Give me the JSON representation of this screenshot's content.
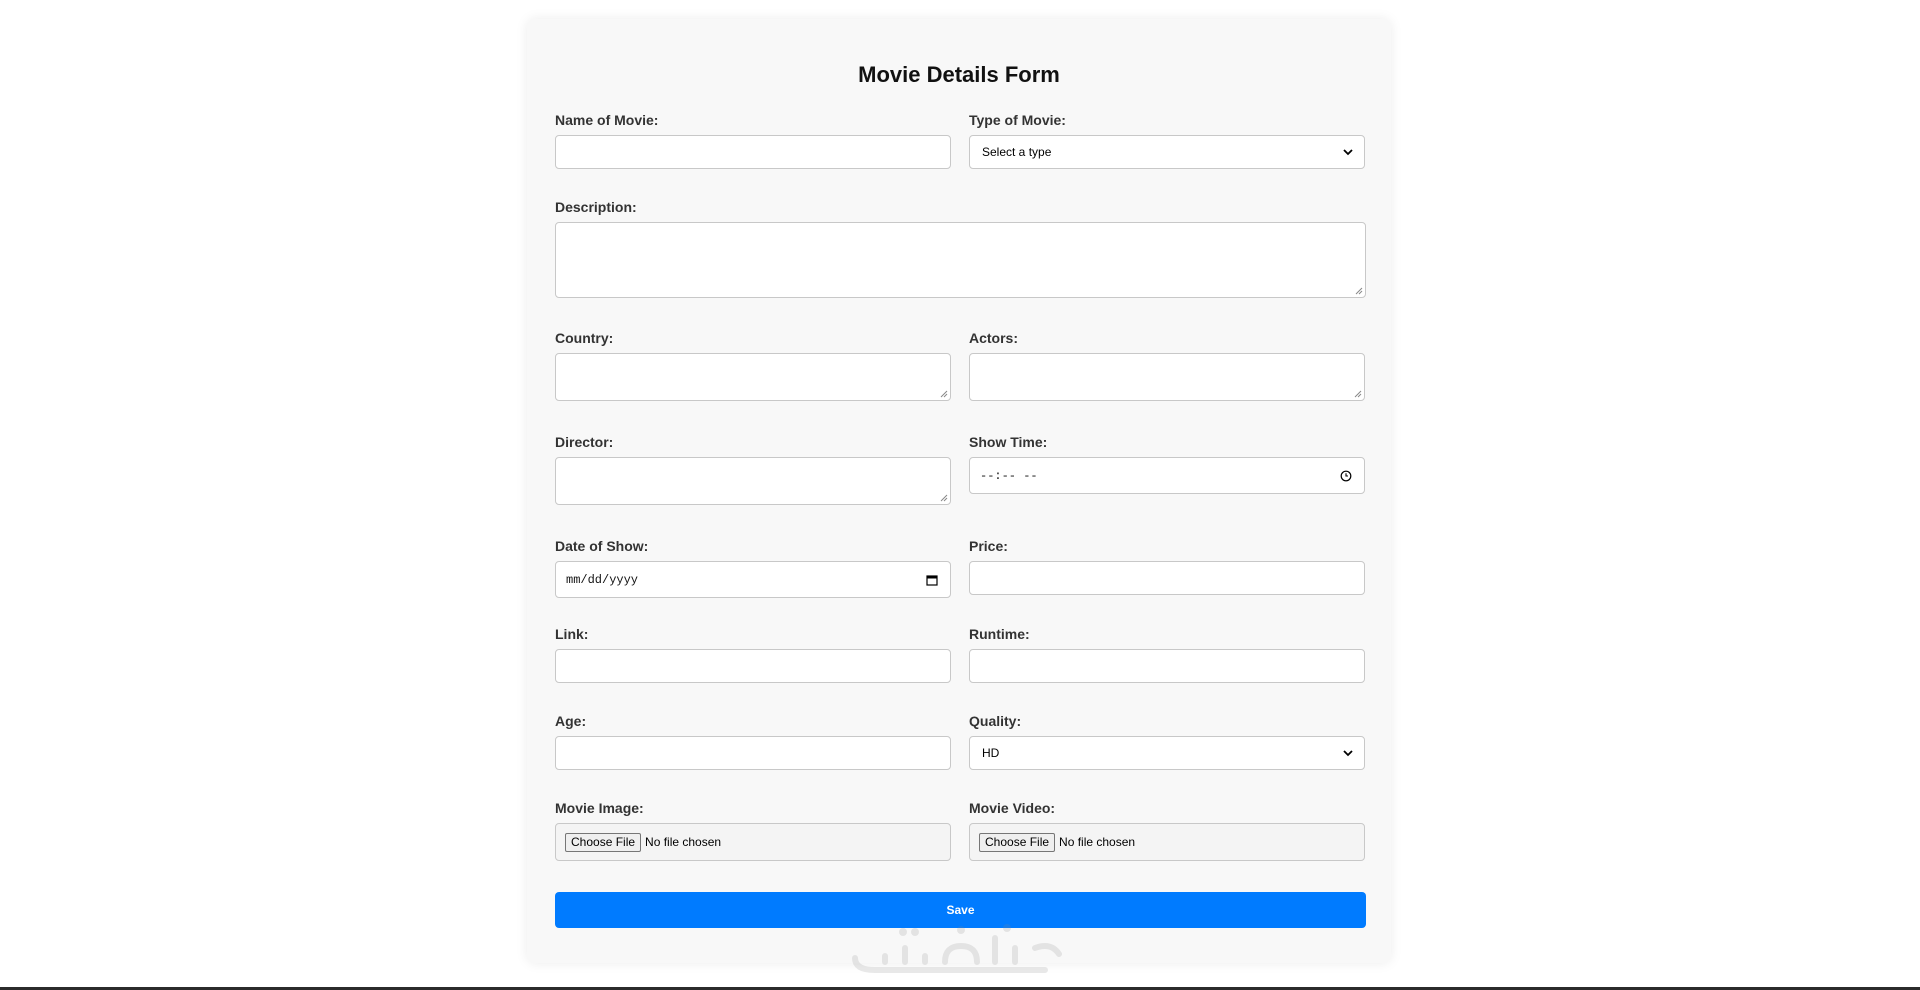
{
  "form": {
    "title": "Movie Details Form",
    "fields": {
      "name_of_movie": {
        "label": "Name of Movie:",
        "value": ""
      },
      "type_of_movie": {
        "label": "Type of Movie:",
        "selected": "Select a type"
      },
      "description": {
        "label": "Description:",
        "value": ""
      },
      "country": {
        "label": "Country:",
        "value": ""
      },
      "actors": {
        "label": "Actors:",
        "value": ""
      },
      "director": {
        "label": "Director:",
        "value": ""
      },
      "show_time": {
        "label": "Show Time:",
        "placeholder": "--:-- --"
      },
      "date_of_show": {
        "label": "Date of Show:",
        "placeholder": "mm/dd/yyyy"
      },
      "price": {
        "label": "Price:",
        "value": ""
      },
      "link": {
        "label": "Link:",
        "value": ""
      },
      "runtime": {
        "label": "Runtime:",
        "value": ""
      },
      "age": {
        "label": "Age:",
        "value": ""
      },
      "quality": {
        "label": "Quality:",
        "selected": "HD"
      },
      "movie_image": {
        "label": "Movie Image:",
        "button": "Choose File",
        "status": "No file chosen"
      },
      "movie_video": {
        "label": "Movie Video:",
        "button": "Choose File",
        "status": "No file chosen"
      }
    },
    "save_label": "Save"
  },
  "colors": {
    "accent": "#007bff",
    "card_background": "#f8f8f8",
    "border": "#c8c8c8"
  },
  "icons": {
    "select_arrow": "chevron-down-icon",
    "time": "clock-icon",
    "date": "calendar-icon",
    "watermark": "khamsat-logo"
  },
  "watermark_text": "خمسات"
}
